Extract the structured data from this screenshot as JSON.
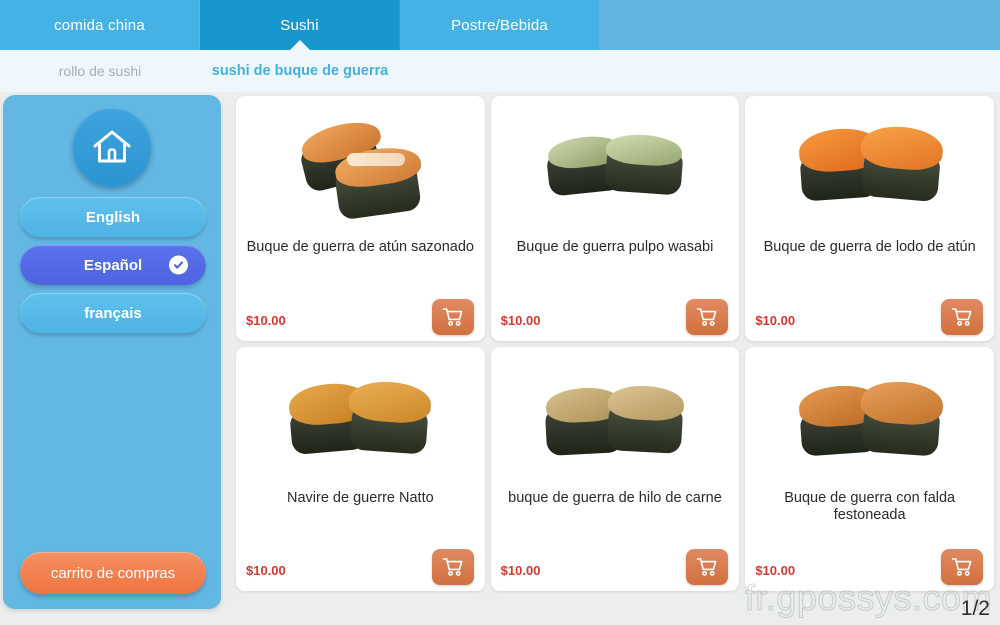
{
  "tabs": [
    {
      "label": "comida china",
      "active": false
    },
    {
      "label": "Sushi",
      "active": true
    },
    {
      "label": "Postre/Bebida",
      "active": false
    }
  ],
  "subnav": [
    {
      "label": "rollo de sushi",
      "active": false
    },
    {
      "label": "sushi de buque de guerra",
      "active": true
    }
  ],
  "sidebar": {
    "home_icon": "home-icon",
    "languages": [
      {
        "label": "English",
        "selected": false
      },
      {
        "label": "Español",
        "selected": true
      },
      {
        "label": "français",
        "selected": false
      }
    ],
    "cart_button": "carrito de compras"
  },
  "products": [
    {
      "name": "Buque de guerra de atún sazonado",
      "price": "$10.00",
      "cart_icon": "shopping-cart-icon"
    },
    {
      "name": "Buque de guerra pulpo wasabi",
      "price": "$10.00",
      "cart_icon": "shopping-cart-icon"
    },
    {
      "name": "Buque de guerra de lodo de atún",
      "price": "$10.00",
      "cart_icon": "shopping-cart-icon"
    },
    {
      "name": "Navire de guerre Natto",
      "price": "$10.00",
      "cart_icon": "shopping-cart-icon"
    },
    {
      "name": "buque de guerra de hilo de carne",
      "price": "$10.00",
      "cart_icon": "shopping-cart-icon"
    },
    {
      "name": "Buque de guerra con falda festoneada",
      "price": "$10.00",
      "cart_icon": "shopping-cart-icon"
    }
  ],
  "footer": {
    "watermark": "fr.gpossys.com",
    "pagination": "1/2"
  },
  "colors": {
    "tab_bar": "#44b2e4",
    "tab_active": "#1897ce",
    "subnav_bg": "#eef7fc",
    "subnav_active": "#45b1e2",
    "sidebar": "#63b7e3",
    "lang_selected": "#5a72ec",
    "accent_orange": "#ef7442",
    "price_red": "#d9362d",
    "page_bg": "#eceded"
  }
}
